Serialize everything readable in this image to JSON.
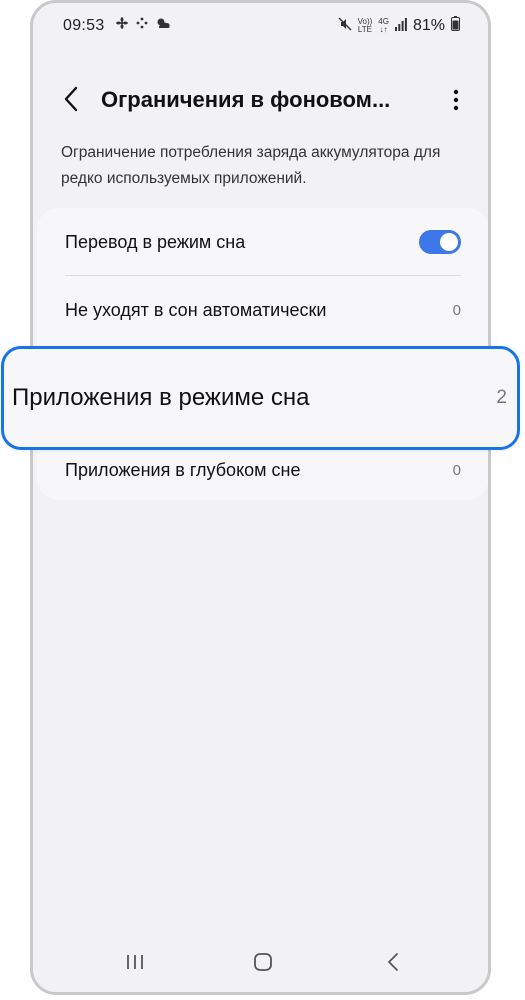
{
  "status_bar": {
    "time": "09:53",
    "battery": "81%",
    "volte_top": "Vo))",
    "volte_bottom": "LTE",
    "network_type": "4G",
    "icons": [
      "fan-icon",
      "dots-icon",
      "weather-icon",
      "mute-icon",
      "signal-icon",
      "battery-icon"
    ]
  },
  "app_bar": {
    "title": "Ограничения в фоновом..."
  },
  "description": "Ограничение потребления заряда аккумулятора для редко используемых приложений.",
  "settings": {
    "sleep_mode": {
      "label": "Перевод в режим сна",
      "enabled": true
    },
    "never_sleeping": {
      "label": "Не уходят в сон автоматически",
      "count": "0"
    },
    "sleeping_apps": {
      "label": "Приложения в режиме сна",
      "count": "2"
    },
    "deep_sleeping_apps": {
      "label": "Приложения в глубоком сне",
      "count": "0"
    }
  },
  "colors": {
    "accent": "#3e78e8",
    "highlight_border": "#1773e6",
    "background": "#f2f2f5",
    "card": "#f7f7fa"
  }
}
